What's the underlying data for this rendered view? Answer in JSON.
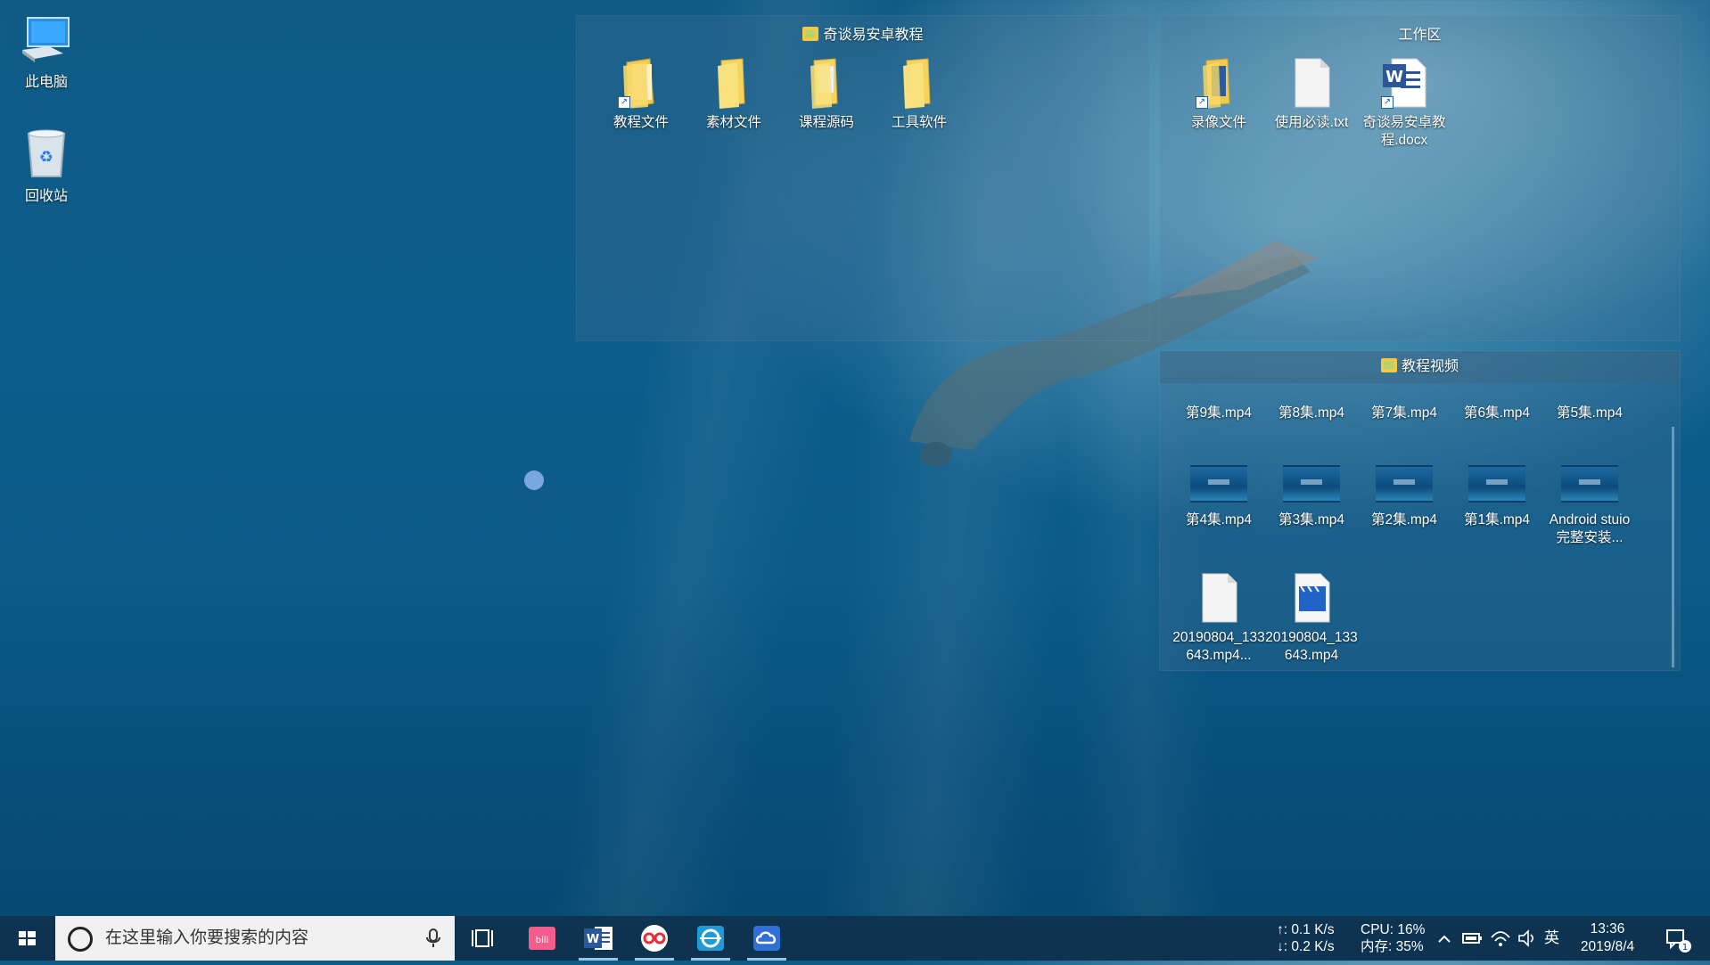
{
  "desktop": {
    "icons": [
      {
        "label": "此电脑",
        "icon": "computer-icon"
      },
      {
        "label": "回收站",
        "icon": "recycle-bin-icon"
      }
    ]
  },
  "fences": {
    "tutorial": {
      "title": "奇谈易安卓教程",
      "items": [
        {
          "label": "教程文件",
          "icon": "folder-shortcut-icon"
        },
        {
          "label": "素材文件",
          "icon": "folder-icon"
        },
        {
          "label": "课程源码",
          "icon": "folder-icon"
        },
        {
          "label": "工具软件",
          "icon": "folder-icon"
        }
      ]
    },
    "workspace": {
      "title": "工作区",
      "items": [
        {
          "label": "录像文件",
          "icon": "folder-shortcut-icon"
        },
        {
          "label": "使用必读.txt",
          "icon": "text-file-icon"
        },
        {
          "label": "奇谈易安卓教程.docx",
          "icon": "word-document-icon"
        }
      ]
    },
    "videos": {
      "title": "教程视频",
      "items": [
        {
          "label": "第9集.mp4"
        },
        {
          "label": "第8集.mp4"
        },
        {
          "label": "第7集.mp4"
        },
        {
          "label": "第6集.mp4"
        },
        {
          "label": "第5集.mp4"
        },
        {
          "label": "第4集.mp4"
        },
        {
          "label": "第3集.mp4"
        },
        {
          "label": "第2集.mp4"
        },
        {
          "label": "第1集.mp4"
        },
        {
          "label": "Android stuio完整安装..."
        },
        {
          "label": "20190804_133643.mp4...",
          "icon": "blank-file-icon"
        },
        {
          "label": "20190804_133643.mp4",
          "icon": "video-file-icon"
        }
      ]
    }
  },
  "taskbar": {
    "search_placeholder": "在这里输入你要搜索的内容",
    "apps": [
      "task-view-icon",
      "bilibili-icon",
      "word-icon",
      "screen-recorder-icon",
      "browser-icon",
      "cloud-sync-icon"
    ],
    "net_up": "↑: 0.1 K/s",
    "net_down": "↓: 0.2 K/s",
    "cpu": "CPU: 16%",
    "mem": "内存: 35%",
    "ime": "英",
    "time": "13:36",
    "date": "2019/8/4",
    "notification_count": "1"
  }
}
